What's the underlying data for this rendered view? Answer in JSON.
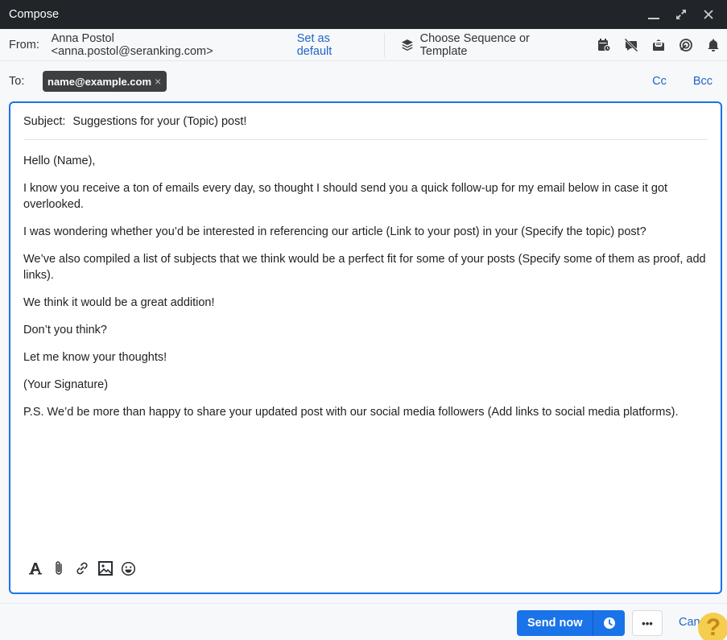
{
  "window": {
    "title": "Compose",
    "controls": [
      "minimize-icon",
      "expand-icon",
      "close-icon"
    ]
  },
  "from": {
    "label": "From:",
    "value": "Anna Postol <anna.postol@seranking.com>",
    "set_default_label": "Set as default",
    "template_label": "Choose Sequence or Template",
    "template_icon": "layers-icon",
    "tool_icons": [
      "schedule-calendar-icon",
      "tracking-off-icon",
      "open-mail-icon",
      "target-icon",
      "bell-icon"
    ]
  },
  "to": {
    "label": "To:",
    "recipients": [
      {
        "email": "name@example.com",
        "remove": "×"
      }
    ],
    "cc_label": "Cc",
    "bcc_label": "Bcc"
  },
  "message": {
    "subject_label": "Subject:",
    "subject": "Suggestions for your (Topic) post!",
    "paragraphs": [
      "Hello (Name),",
      "I know you receive a ton of emails every day, so thought I should send you a quick follow-up for my email below in case it got overlooked.",
      "I was wondering whether you’d be interested in referencing our article (Link to your post) in your (Specify the topic) post?",
      "We’ve also compiled a list of subjects that we think would be a perfect fit for some of your posts (Specify some of them as proof, add links).",
      "We think it would be a great addition!",
      "Don’t you think?",
      "Let me know your thoughts!",
      "(Your Signature)",
      "P.S. We’d be more than happy to share your updated post with our social media followers (Add links to social media platforms)."
    ],
    "format_tools": [
      "text-format-icon",
      "attachment-icon",
      "link-icon",
      "image-icon",
      "emoji-icon"
    ]
  },
  "footer": {
    "send_label": "Send now",
    "schedule_icon": "clock-icon",
    "more_label": "•••",
    "cancel_label": "Cancel",
    "help_label": "?"
  },
  "colors": {
    "accent": "#1a73e8",
    "titlebar": "#212428",
    "link": "#1f64c8",
    "chip": "#3d3f42",
    "help": "#f5cd4f"
  }
}
